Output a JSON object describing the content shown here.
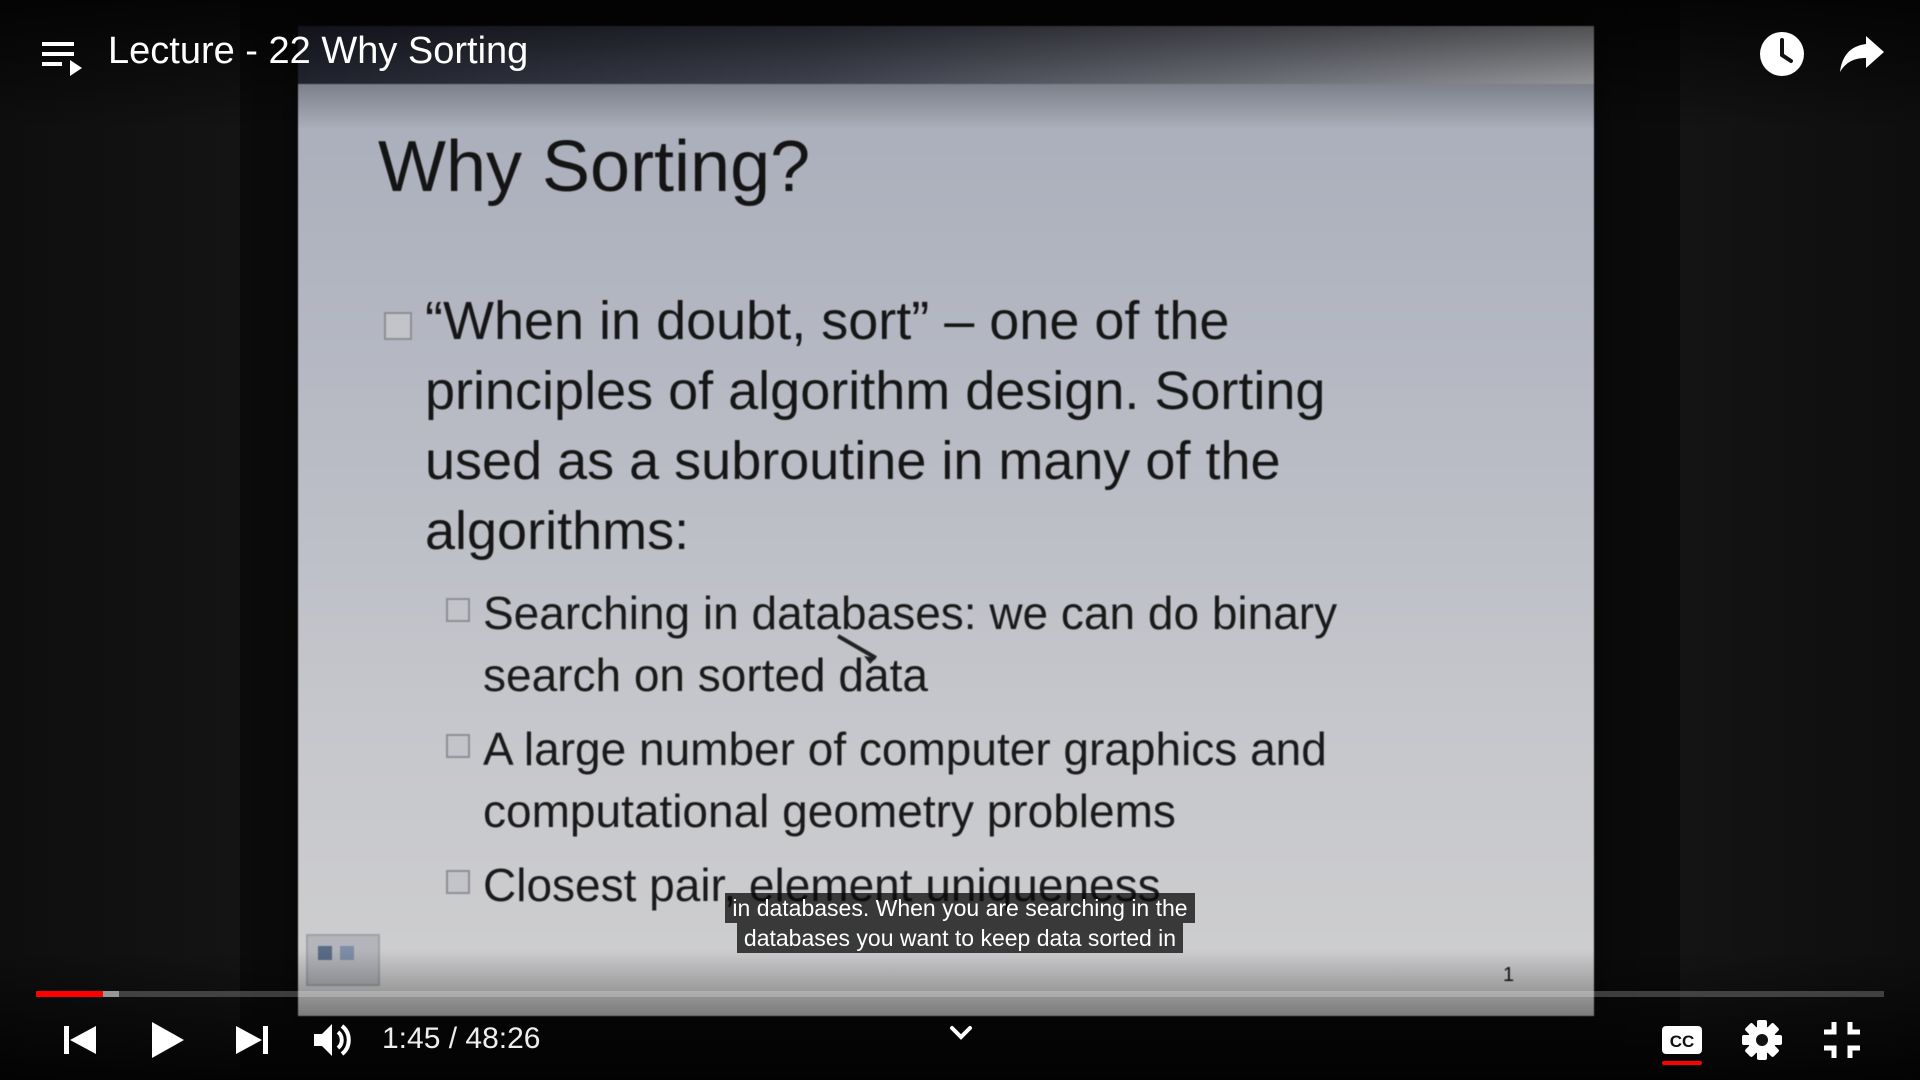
{
  "header": {
    "title": "Lecture - 22 Why Sorting"
  },
  "slide": {
    "heading": "Why Sorting?",
    "bullet": "“When in doubt, sort” – one of the principles of algorithm design. Sorting used as a subroutine in many of the algorithms:",
    "sub_bullets": [
      "Searching in databases: we can do binary search on sorted data",
      "A large number of computer graphics and computational geometry problems",
      "Closest pair, element uniqueness"
    ],
    "page_number": "1"
  },
  "captions": {
    "line1": "in databases. When you are searching in the",
    "line2": "databases you want to keep data sorted in"
  },
  "controls": {
    "current_time": "1:45",
    "duration": "48:26",
    "time_text": "1:45 / 48:26",
    "progress_played_percent": 3.6,
    "progress_buffered_percent": 4.5,
    "captions_enabled": true
  },
  "colors": {
    "progress": "#ff0000",
    "cc_indicator": "#ff0000"
  },
  "icons": {
    "playlist": "playlist-icon",
    "watch_later": "clock-icon",
    "share": "share-icon",
    "previous": "skip-previous-icon",
    "play": "play-icon",
    "next": "skip-next-icon",
    "volume": "volume-icon",
    "chevron": "chevron-down-icon",
    "captions": "cc-icon",
    "settings": "gear-icon",
    "exit_fullscreen": "exit-fullscreen-icon"
  }
}
